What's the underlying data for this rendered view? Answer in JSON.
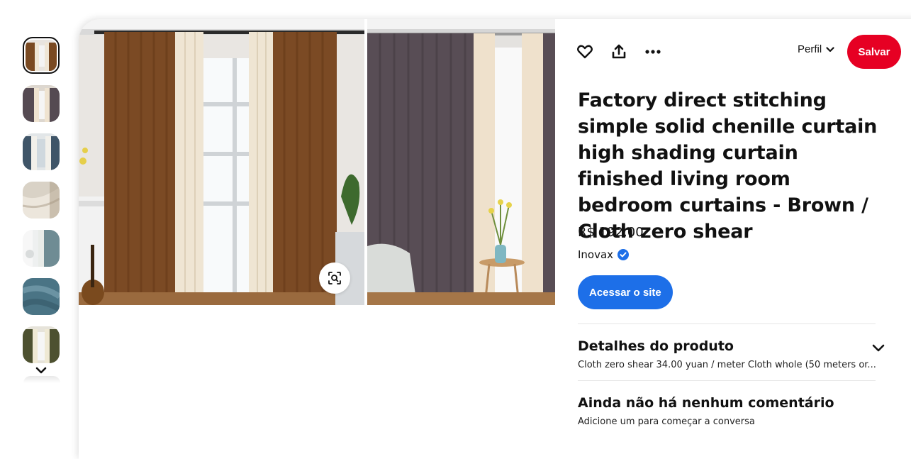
{
  "thumbnails": [
    {
      "label": "brown-cream-curtains",
      "selected": true
    },
    {
      "label": "grey-curtains"
    },
    {
      "label": "blue-white-curtains"
    },
    {
      "label": "cream-draped-curtain"
    },
    {
      "label": "blue-grey-curtains-room"
    },
    {
      "label": "blue-fabric-closeup"
    },
    {
      "label": "olive-curtains"
    }
  ],
  "actions": {
    "like_icon": "heart-icon",
    "share_icon": "share-icon",
    "more_icon": "more-icon",
    "profile_label": "Perfil",
    "save_label": "Salvar"
  },
  "product": {
    "title": "Factory direct stitching simple solid chenille curtain high shading curtain finished living room bedroom curtains - Brown / Cloth zero shear",
    "price": "R$ 192,00",
    "seller": "Inovax",
    "visit_label": "Acessar o site"
  },
  "details": {
    "title": "Detalhes do produto",
    "summary": "Cloth zero shear 34.00 yuan / meter Cloth whole (50 meters or..."
  },
  "comments": {
    "title": "Ainda não há nenhum comentário",
    "prompt": "Adicione um para começar a conversa"
  },
  "colors": {
    "save": "#e60023",
    "visit": "#1d6fe8",
    "verified": "#1d6fe8"
  }
}
